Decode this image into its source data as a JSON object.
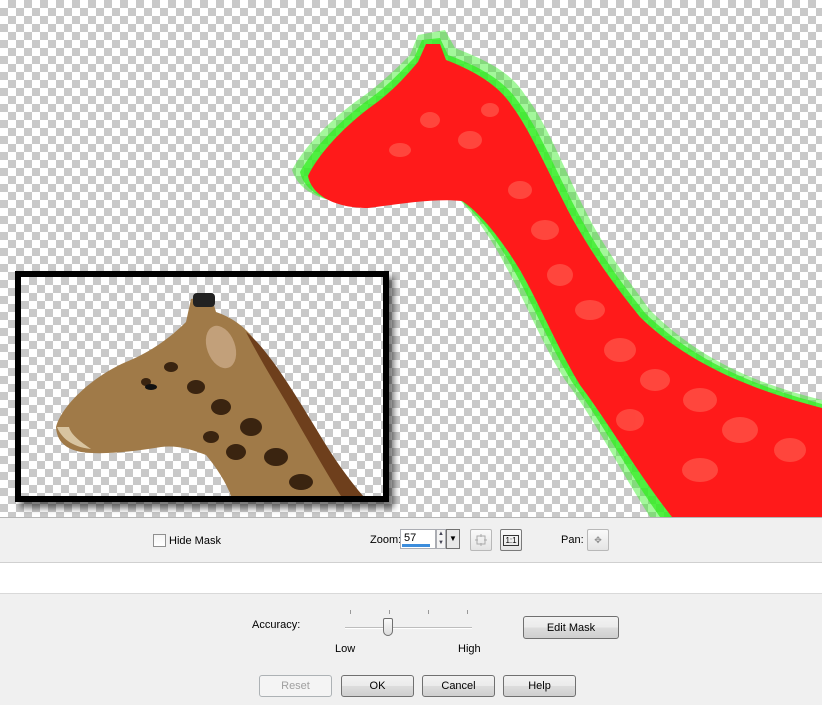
{
  "canvas": {
    "hide_mask_label": "Hide Mask",
    "colors": {
      "mask_red": "#ff1a1a",
      "edge_green": "#33ee22",
      "checker": "#c9c9c9"
    }
  },
  "toolbar": {
    "zoom_label": "Zoom:",
    "zoom_value": "57",
    "fit_icon": "fit-to-window-icon",
    "actual_size_label": "1:1",
    "pan_label": "Pan:",
    "pan_icon": "move-cross-icon"
  },
  "settings": {
    "accuracy_label": "Accuracy:",
    "accuracy_low_label": "Low",
    "accuracy_high_label": "High",
    "edit_mask_label": "Edit Mask"
  },
  "dialog_buttons": {
    "reset_label": "Reset",
    "ok_label": "OK",
    "cancel_label": "Cancel",
    "help_label": "Help"
  }
}
